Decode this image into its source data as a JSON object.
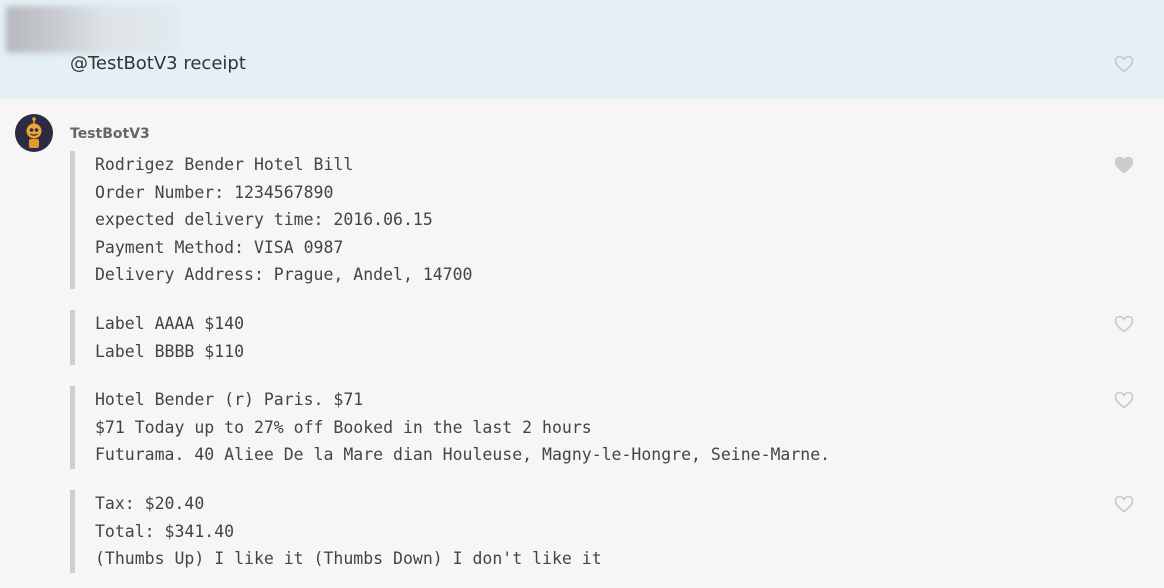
{
  "user_message": {
    "text": "@TestBotV3 receipt"
  },
  "bot": {
    "name": "TestBotV3"
  },
  "blocks": [
    {
      "lines": [
        "Rodrigez Bender Hotel Bill",
        "Order Number: 1234567890",
        "expected delivery time: 2016.06.15",
        "Payment Method: VISA 0987",
        "Delivery Address: Prague, Andel, 14700"
      ],
      "liked": true
    },
    {
      "lines": [
        "Label AAAA $140",
        "Label BBBB $110"
      ],
      "liked": false
    },
    {
      "lines": [
        "Hotel Bender (r) Paris. $71",
        "$71 Today up to 27% off Booked in the last 2 hours",
        "Futurama. 40 Aliee De la Mare dian Houleuse, Magny-le-Hongre, Seine-Marne."
      ],
      "liked": false
    },
    {
      "lines": [
        "Tax: $20.40",
        "Total: $341.40",
        "(Thumbs Up) I like it (Thumbs Down) I don't like it"
      ],
      "liked": false
    }
  ],
  "icons": {
    "like": "heart-icon",
    "avatar": "bot-avatar"
  },
  "colors": {
    "user_bg": "#e4eff6",
    "page_bg": "#f6f6f6",
    "heart_outline": "#c8c8c8",
    "heart_filled": "#cccccc",
    "quote_bar": "#cfcfcf"
  }
}
